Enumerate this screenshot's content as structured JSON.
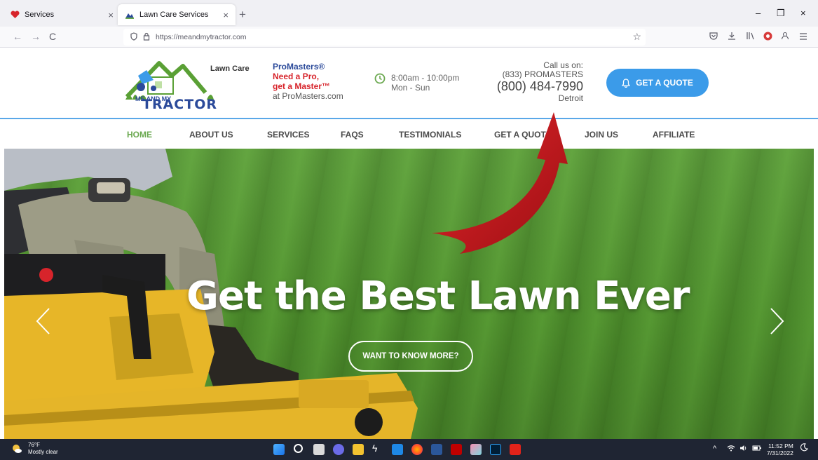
{
  "browser": {
    "tabs": [
      {
        "title": "Services",
        "close": "×"
      },
      {
        "title": "Lawn Care Services",
        "close": "×"
      }
    ],
    "new_tab": "+",
    "window_controls": [
      "–",
      "❐",
      "×"
    ],
    "back": "←",
    "forward": "→",
    "reload": "C",
    "url": "https://meandmytractor.com",
    "bookmark": "☆"
  },
  "header": {
    "logo": {
      "lawn_care": "Lawn Care",
      "me_and_my": "ME AND MY",
      "tractor": "TRACTOR"
    },
    "promo": {
      "line1": "ProMasters®",
      "line2": "Need a Pro,",
      "line3": "get a Master™",
      "line4": "at ProMasters.com"
    },
    "hours": {
      "time": "8:00am - 10:00pm",
      "days": "Mon - Sun"
    },
    "call": {
      "label": "Call us on:",
      "vanity": "(833) PROMASTERS",
      "phone": "(800) 484-7990",
      "city": "Detroit"
    },
    "quote_button": "GET A QUOTE"
  },
  "menu": [
    "HOME",
    "ABOUT US",
    "SERVICES",
    "FAQS",
    "TESTIMONIALS",
    "GET A QUOTE",
    "JOIN US",
    "AFFILIATE"
  ],
  "hero": {
    "headline": "Get the Best Lawn Ever",
    "cta": "WANT TO KNOW MORE?"
  },
  "taskbar": {
    "weather_temp": "76°F",
    "weather_desc": "Mostly clear",
    "time": "11:52 PM",
    "date": "7/31/2022"
  },
  "colors": {
    "accent_blue": "#3b9be9",
    "menu_active_green": "#6aa84f",
    "promo_red": "#d7242b",
    "brand_navy": "#2b4a9a",
    "annotation_arrow_red": "#c0161b"
  }
}
